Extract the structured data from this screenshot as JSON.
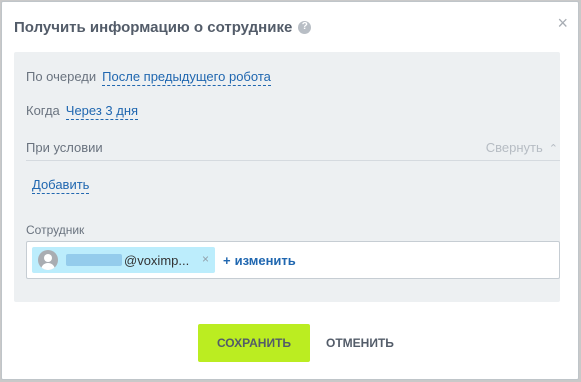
{
  "dialog": {
    "title": "Получить информацию о сотруднике",
    "help_icon": "?",
    "close_icon": "×"
  },
  "settings": {
    "queue_label": "По очереди",
    "queue_value": "После предыдущего робота",
    "when_label": "Когда",
    "when_value": "Через 3 дня",
    "condition_label": "При условии",
    "collapse_label": "Свернуть",
    "add_label": "Добавить"
  },
  "employee": {
    "label": "Сотрудник",
    "chip_name": "@voximp...",
    "chip_remove": "×",
    "change_plus": "+",
    "change_label": "изменить"
  },
  "footer": {
    "save_label": "СОХРАНИТЬ",
    "cancel_label": "ОТМЕНИТЬ"
  },
  "colors": {
    "accent_green": "#bbed21",
    "link_blue": "#2067b0",
    "chip_bg": "#bcedfc"
  }
}
